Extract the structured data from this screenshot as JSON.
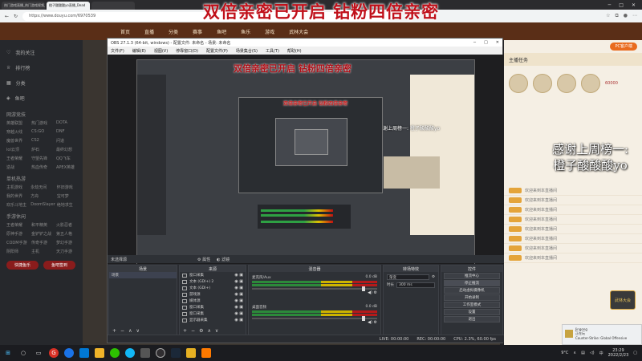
{
  "browser": {
    "tabs": [
      "热门游戏直播_热门游戏视频_",
      "橙子酸酸酸yo直播_Dead",
      ""
    ],
    "url": "https://www.douyu.com/6970539"
  },
  "banner": "双倍亲密已开启 钻粉四倍亲密",
  "nav": [
    "首页",
    "直播",
    "分类",
    "赛事",
    "鱼吧",
    "鱼乐",
    "游戏",
    "武林大会"
  ],
  "sidebar": {
    "items": [
      "我的关注",
      "排行榜",
      "分类",
      "鱼吧"
    ],
    "sec1": "网游竞技",
    "grid1": [
      "英雄联盟",
      "热门游戏",
      "DOTA",
      "穿越火线",
      "CS:GO",
      "DNF",
      "魔兽世界",
      "CS2",
      "问道",
      "lol云顶",
      "炉石",
      "最终幻想",
      "王者荣耀",
      "守望先锋",
      "QQ飞车",
      "逆战",
      "热血传奇",
      "APEX英雄"
    ],
    "sec2": "单机热游",
    "grid2": [
      "主机游戏",
      "永劫无间",
      "怀旧游戏",
      "我的世界",
      "方舟",
      "宝可梦",
      "欢乐斗地主",
      "DoomSlayer",
      "绝地求生"
    ],
    "sec3": "手游休闲",
    "grid3": [
      "王者荣耀",
      "和平精英",
      "火影忍者",
      "原神手游",
      "金铲铲之战",
      "第五人格",
      "CODM手游",
      "传奇手游",
      "梦幻手游",
      "阴阳师",
      "主机",
      "天刀手游"
    ],
    "btn1": "快捷鱼乐",
    "btn2": "鱼吧签到"
  },
  "obs": {
    "title": "OBS 27.1.3 (64-bit, windows) - 配置文件: 未命名 - 场景: 未命名",
    "menu": [
      "文件(F)",
      "编辑(E)",
      "视图(V)",
      "停靠窗口(D)",
      "配置文件(P)",
      "场景集合(S)",
      "工具(T)",
      "帮助(H)"
    ],
    "nested_title": "双倍亲密已开启 钻粉四倍亲密",
    "nested_title2": "双倍亲密已开启 钻粉四倍亲密",
    "nested_side": "感谢上周榜一: 橙子酸酸酸yo",
    "source_label": "未选择源",
    "props_btn": "属性",
    "filter_btn": "滤镜",
    "docks": {
      "scenes": "场景",
      "sources": "来源",
      "mixer": "混音器",
      "transitions": "转场特效",
      "controls": "控件"
    },
    "scene_items": [
      "场景"
    ],
    "source_items": [
      "窗口采集",
      "文本 (GDI+) 2",
      "文本 (GDI+)",
      "游戏源",
      "媒体源",
      "窗口采集",
      "窗口采集",
      "显示器采集"
    ],
    "mixer_items": [
      {
        "name": "麦克风/Aux",
        "db": "0.0 dB"
      },
      {
        "name": "桌面音频",
        "db": "0.0 dB"
      }
    ],
    "transition": {
      "type": "渐变",
      "duration_label": "时长",
      "duration": "300 ms"
    },
    "controls": [
      "推流中心",
      "停止推流",
      "启动虚拟摄像机",
      "开始录制",
      "工作室模式",
      "设置",
      "退出"
    ],
    "status": {
      "live": "LIVE: 00:00:00",
      "rec": "REC: 00:00:00",
      "cpu": "CPU: 2.3%, 60.00 fps"
    }
  },
  "right": {
    "tabs": [
      "PC客户端"
    ],
    "rank_title": "主播任务",
    "gift_label": "60000",
    "side_text_1": "感谢上周榜一:",
    "side_text_2": "橙子酸酸酸yo",
    "lines": [
      "欢迎来到本直播间",
      "欢迎来到本直播间",
      "欢迎来到本直播间",
      "欢迎来到本直播间",
      "欢迎来到本直播间",
      "欢迎来到本直播间",
      "欢迎来到本直播间",
      "欢迎来到本直播间"
    ],
    "badge": "武林大会"
  },
  "notification": {
    "app": "Jingong",
    "line1": "正在玩",
    "line2": "Counter-Strike: Global Offensive"
  },
  "taskbar": {
    "weather": "9°C",
    "lang": "中",
    "time": "23:29",
    "date": "2022/2/23"
  }
}
